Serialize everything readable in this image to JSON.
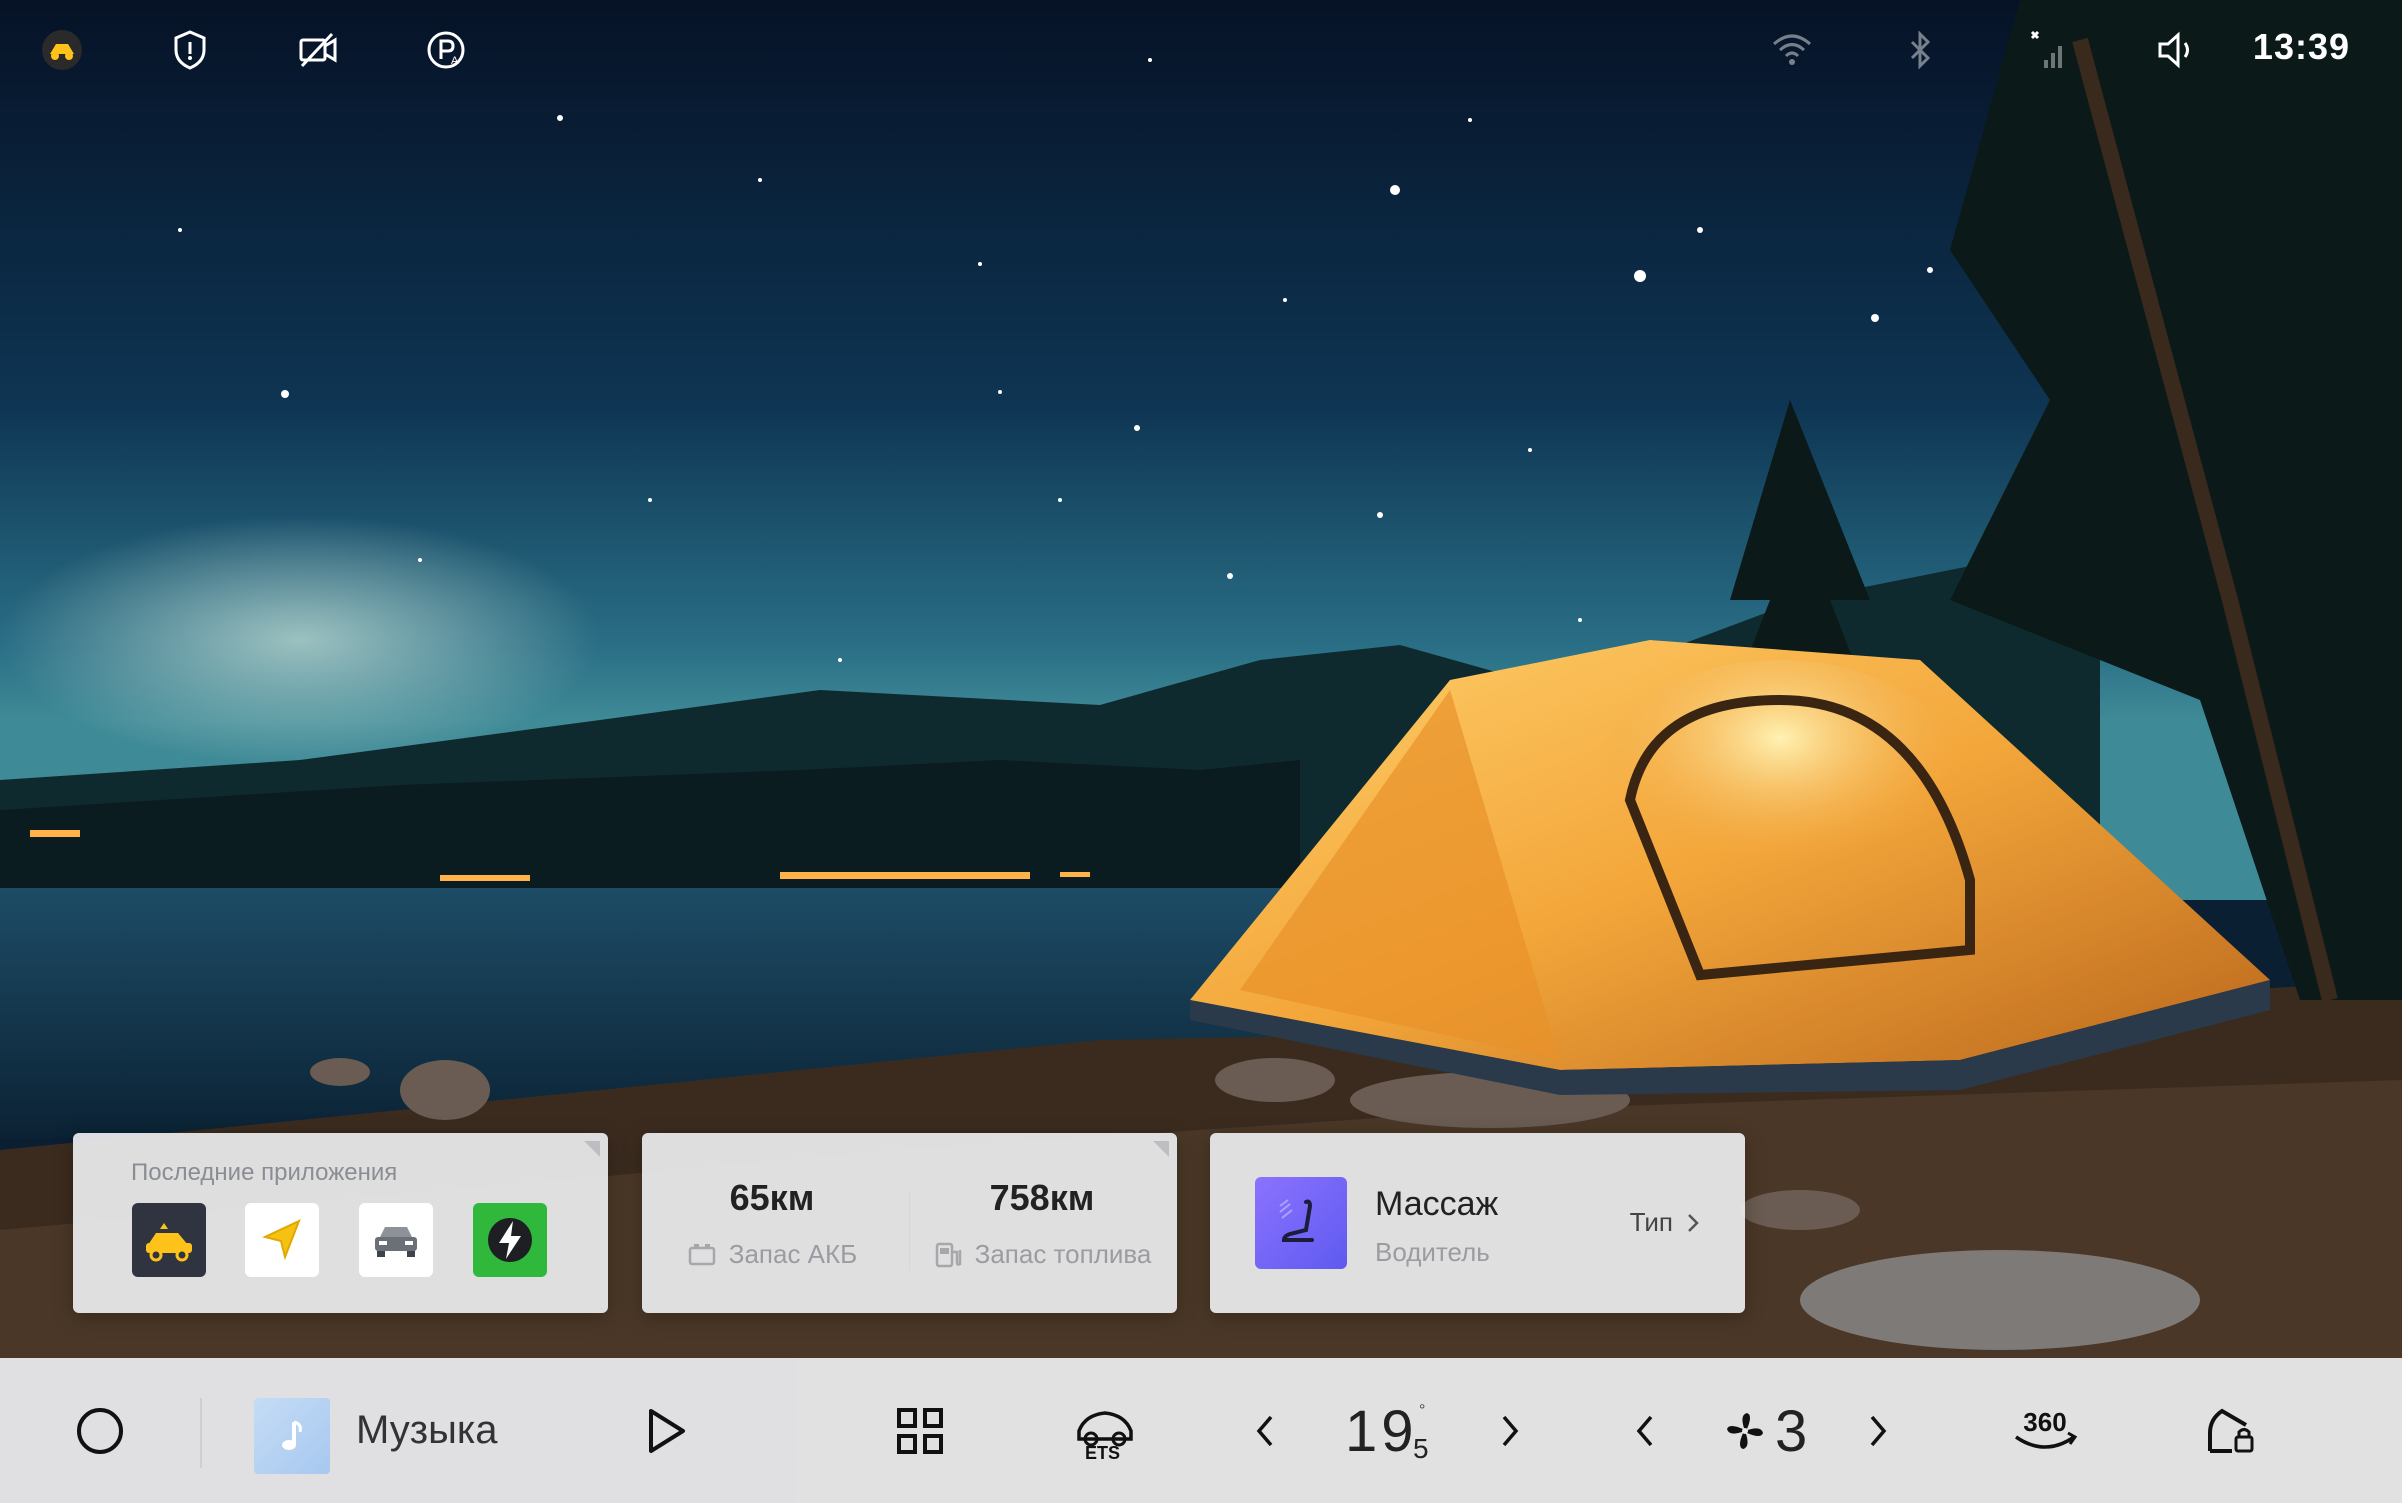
{
  "status_bar": {
    "icons": [
      "ets-badge-icon",
      "shield-icon",
      "camera-off-icon",
      "parking-assist-icon",
      "wifi-icon",
      "bluetooth-icon",
      "signal-off-icon",
      "volume-icon"
    ],
    "time": "13:39"
  },
  "recent_apps": {
    "title": "Последние приложения",
    "apps": [
      {
        "icon": "ets-car-app-icon",
        "bg": "#2f3440"
      },
      {
        "icon": "navigation-app-icon",
        "bg": "#ffffff"
      },
      {
        "icon": "car-app-icon",
        "bg": "#ffffff"
      },
      {
        "icon": "charging-app-icon",
        "bg": "#2fb83c"
      }
    ]
  },
  "range": {
    "battery": {
      "value": "65км",
      "label": "Запас АКБ"
    },
    "fuel": {
      "value": "758км",
      "label": "Запас топлива"
    }
  },
  "massage": {
    "title": "Массаж",
    "subtitle": "Водитель",
    "type_label": "Тип"
  },
  "dock": {
    "music_label": "Музыка",
    "temperature_int": "19",
    "temperature_dec": "5",
    "temperature_deg": "°",
    "fan_level": "3",
    "camera_360_label": "360"
  },
  "colors": {
    "tent": "#f3a63a",
    "sky_top": "#071426",
    "sky_bottom": "#1c5a7a",
    "charge_green": "#2fb83c",
    "massage_purple": "#7466f6"
  }
}
